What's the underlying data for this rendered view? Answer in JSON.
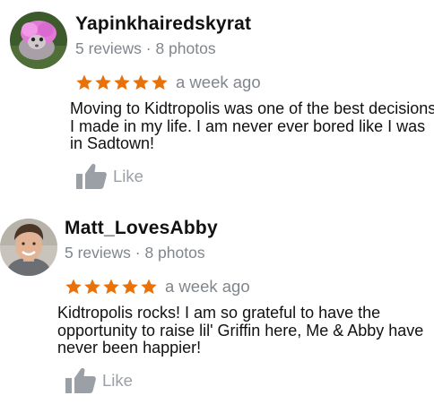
{
  "reviews": [
    {
      "author": "Yapinkhairedskyrat",
      "meta": "5 reviews · 8 photos",
      "rating": 5,
      "time": "a week ago",
      "text": "Moving to Kidtropolis was one of the best decisions I made in my life. I am never ever bored like I was in Sadtown!",
      "like_label": "Like"
    },
    {
      "author": "Matt_LovesAbby",
      "meta": "5 reviews · 8 photos",
      "rating": 5,
      "time": "a week ago",
      "text": "Kidtropolis rocks! I am so grateful to have the opportunity to raise lil' Griffin here, Me & Abby have never been happier!",
      "like_label": "Like"
    }
  ],
  "colors": {
    "star": "#e8710a",
    "meta_text": "#80868b",
    "like_icon": "#9aa0a6"
  }
}
